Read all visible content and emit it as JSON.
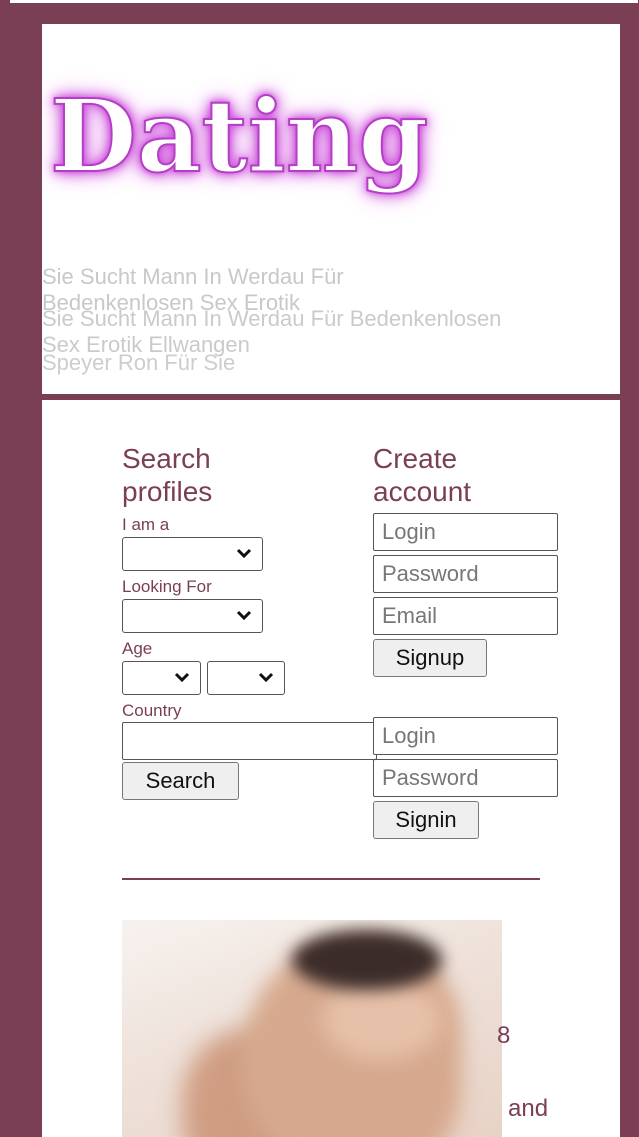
{
  "header": {
    "logo_text": "Dating",
    "tagline_1": "Sie Sucht Mann In Werdau Für Bedenkenlosen Sex Erotik",
    "tagline_2": "Sie Sucht Mann In Werdau Für Bedenkenlosen Sex Erotik Ellwangen",
    "tagline_3": "Speyer Ron Für Sie"
  },
  "search": {
    "title": "Search profiles",
    "i_am_label": "I am a",
    "looking_for_label": "Looking For",
    "age_label": "Age",
    "country_label": "Country",
    "search_button": "Search"
  },
  "create_account": {
    "title": "Create account",
    "login_placeholder": "Login",
    "password_placeholder": "Password",
    "email_placeholder": "Email",
    "signup_button": "Signup"
  },
  "signin": {
    "login_placeholder": "Login",
    "password_placeholder": "Password",
    "signin_button": "Signin"
  },
  "profile_teaser": {
    "text_1": "8",
    "text_2": "and"
  },
  "colors": {
    "accent": "#7a3f55",
    "logo_glow": "#c63bd6"
  },
  "icons": {
    "select_arrow": "chevron-down-icon"
  }
}
